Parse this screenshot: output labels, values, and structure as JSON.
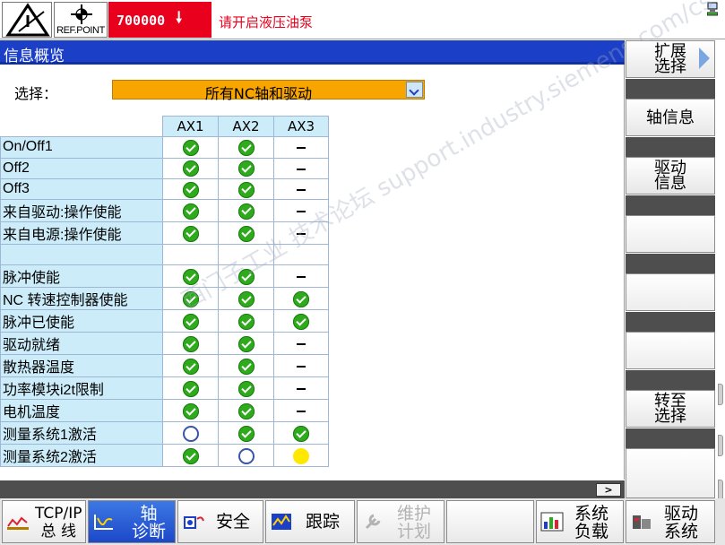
{
  "status": {
    "refpoint_label": "REF.POINT",
    "alarm_number": "700000",
    "alarm_text": "请开启液压油泵",
    "colors": {
      "alarm_bg": "#e8001c",
      "alarm_text": "#e8001c"
    }
  },
  "screen": {
    "title": "信息概览",
    "select_label": "选择：",
    "select_value": "所有NC轴和驱动"
  },
  "table": {
    "columns": [
      "AX1",
      "AX2",
      "AX3"
    ],
    "rows": [
      {
        "label": "On/Off1",
        "states": [
          "ok",
          "ok",
          "none"
        ]
      },
      {
        "label": "Off2",
        "states": [
          "ok",
          "ok",
          "none"
        ]
      },
      {
        "label": "Off3",
        "states": [
          "ok",
          "ok",
          "none"
        ]
      },
      {
        "label": "来自驱动:操作使能",
        "states": [
          "ok",
          "ok",
          "none"
        ]
      },
      {
        "label": "来自电源:操作使能",
        "states": [
          "ok",
          "ok",
          "none"
        ]
      },
      {
        "label": "",
        "states": [
          "blank",
          "blank",
          "blank"
        ]
      },
      {
        "label": "脉冲使能",
        "states": [
          "ok",
          "ok",
          "none"
        ]
      },
      {
        "label": "NC 转速控制器使能",
        "states": [
          "ok",
          "ok",
          "ok"
        ]
      },
      {
        "label": "脉冲已使能",
        "states": [
          "ok",
          "ok",
          "ok"
        ]
      },
      {
        "label": "驱动就绪",
        "states": [
          "ok",
          "ok",
          "none"
        ]
      },
      {
        "label": "散热器温度",
        "states": [
          "ok",
          "ok",
          "none"
        ]
      },
      {
        "label": "功率模块i2t限制",
        "states": [
          "ok",
          "ok",
          "none"
        ]
      },
      {
        "label": "电机温度",
        "states": [
          "ok",
          "ok",
          "none"
        ]
      },
      {
        "label": "测量系统1激活",
        "states": [
          "inactive",
          "ok",
          "ok"
        ]
      },
      {
        "label": "测量系统2激活",
        "states": [
          "ok",
          "inactive",
          "warning"
        ]
      }
    ],
    "state_icons": {
      "ok": "green-check-icon",
      "inactive": "empty-ring-icon",
      "warning": "yellow-dot-icon",
      "none": "dash"
    }
  },
  "watermark": "西门子工业 技术论坛 support.industry.siemens.com/cs",
  "right_softkeys": [
    {
      "label": "扩展\n选择",
      "arrow": true
    },
    {
      "label": "轴信息"
    },
    {
      "label": "驱动\n信息"
    },
    {
      "label": ""
    },
    {
      "label": ""
    },
    {
      "label": ""
    },
    {
      "label": "转至\n选择"
    },
    {
      "label": ""
    }
  ],
  "bottom_softkeys": [
    {
      "label": "TCP/IP\n总 线",
      "icon": "bus-icon"
    },
    {
      "label": "轴\n诊断",
      "icon": "axis-diagnosis-icon",
      "active": true
    },
    {
      "label": "安全",
      "icon": "safety-icon"
    },
    {
      "label": "跟踪",
      "icon": "trace-icon"
    },
    {
      "label": "维护\n计划",
      "icon": "maintenance-icon",
      "disabled": true
    },
    {
      "label": "",
      "icon": ""
    },
    {
      "label": "系统\n负载",
      "icon": "system-load-icon"
    },
    {
      "label": "驱动\n系统",
      "icon": "drive-system-icon"
    }
  ],
  "scroll_button": ">"
}
